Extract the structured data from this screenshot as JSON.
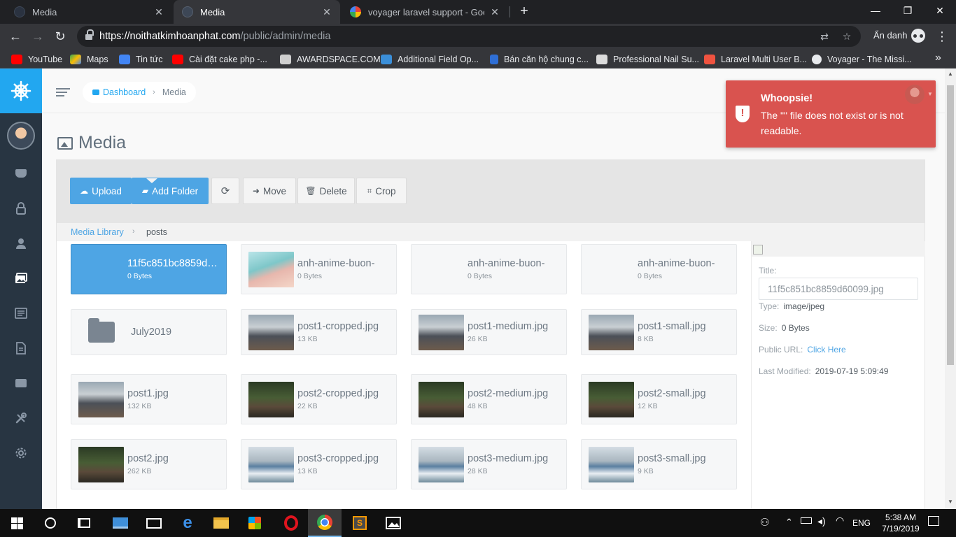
{
  "browser": {
    "tabs": [
      {
        "title": "Media",
        "active": false
      },
      {
        "title": "Media",
        "active": true
      },
      {
        "title": "voyager laravel support - Google",
        "active": false
      }
    ],
    "url_domain": "https://noithatkimhoanphat.com",
    "url_path": "/public/admin/media",
    "incognito_label": "Ẩn danh",
    "bookmarks": [
      {
        "label": "YouTube",
        "color": "#ff0000"
      },
      {
        "label": "Maps",
        "color": "#34a853"
      },
      {
        "label": "Tin tức",
        "color": "#4285f4"
      },
      {
        "label": "Cài đặt cake php -...",
        "color": "#ff0000"
      },
      {
        "label": "AWARDSPACE.COM",
        "color": "#cfcfcf"
      },
      {
        "label": "Additional Field Op...",
        "color": "#3b8fd9"
      },
      {
        "label": "Bán căn hộ chung c...",
        "color": "#2f6fd6"
      },
      {
        "label": "Professional Nail Su...",
        "color": "#dcdcdc"
      },
      {
        "label": "Laravel Multi User B...",
        "color": "#f05340"
      },
      {
        "label": "Voyager - The Missi...",
        "color": "#e8eaed"
      }
    ]
  },
  "breadcrumb": {
    "dashboard": "Dashboard",
    "current": "Media"
  },
  "page": {
    "title": "Media"
  },
  "toolbar": {
    "upload": "Upload",
    "add_folder": "Add Folder",
    "move": "Move",
    "delete": "Delete",
    "crop": "Crop"
  },
  "library": {
    "root": "Media Library",
    "current": "posts"
  },
  "files": [
    {
      "name": "11f5c851bc8859d60099.jpg",
      "size": "0 Bytes",
      "thumb": "blank",
      "selected": true
    },
    {
      "name": "anh-anime-buon-",
      "size": "0 Bytes",
      "thumb": "anime",
      "selected": false
    },
    {
      "name": "anh-anime-buon-",
      "size": "0 Bytes",
      "thumb": "blank",
      "selected": false
    },
    {
      "name": "anh-anime-buon-",
      "size": "0 Bytes",
      "thumb": "blank",
      "selected": false
    },
    {
      "name": "July2019",
      "size": "",
      "thumb": "folder",
      "selected": false
    },
    {
      "name": "post1-cropped.jpg",
      "size": "13 KB",
      "thumb": "mountain",
      "selected": false
    },
    {
      "name": "post1-medium.jpg",
      "size": "26 KB",
      "thumb": "mountain",
      "selected": false
    },
    {
      "name": "post1-small.jpg",
      "size": "8 KB",
      "thumb": "mountain",
      "selected": false
    },
    {
      "name": "post1.jpg",
      "size": "132 KB",
      "thumb": "mountain",
      "selected": false
    },
    {
      "name": "post2-cropped.jpg",
      "size": "22 KB",
      "thumb": "bridge",
      "selected": false
    },
    {
      "name": "post2-medium.jpg",
      "size": "48 KB",
      "thumb": "bridge",
      "selected": false
    },
    {
      "name": "post2-small.jpg",
      "size": "12 KB",
      "thumb": "bridge",
      "selected": false
    },
    {
      "name": "post2.jpg",
      "size": "262 KB",
      "thumb": "bridge",
      "selected": false
    },
    {
      "name": "post3-cropped.jpg",
      "size": "13 KB",
      "thumb": "river",
      "selected": false
    },
    {
      "name": "post3-medium.jpg",
      "size": "28 KB",
      "thumb": "river",
      "selected": false
    },
    {
      "name": "post3-small.jpg",
      "size": "9 KB",
      "thumb": "river",
      "selected": false
    }
  ],
  "details": {
    "title_label": "Title:",
    "title_value": "11f5c851bc8859d60099.jpg",
    "type_label": "Type:",
    "type_value": "image/jpeg",
    "size_label": "Size:",
    "size_value": "0 Bytes",
    "url_label": "Public URL:",
    "url_value": "Click Here",
    "modified_label": "Last Modified:",
    "modified_value": "2019-07-19 5:09:49"
  },
  "toast": {
    "title": "Whoopsie!",
    "message": "The \"\" file does not exist or is not readable."
  },
  "taskbar": {
    "language": "ENG",
    "time": "5:38 AM",
    "date": "7/19/2019"
  },
  "colors": {
    "voyager_blue": "#22a7f0",
    "sidebar": "#283542",
    "primary_button": "#4ea5e4",
    "toast_danger": "#d9534f"
  }
}
